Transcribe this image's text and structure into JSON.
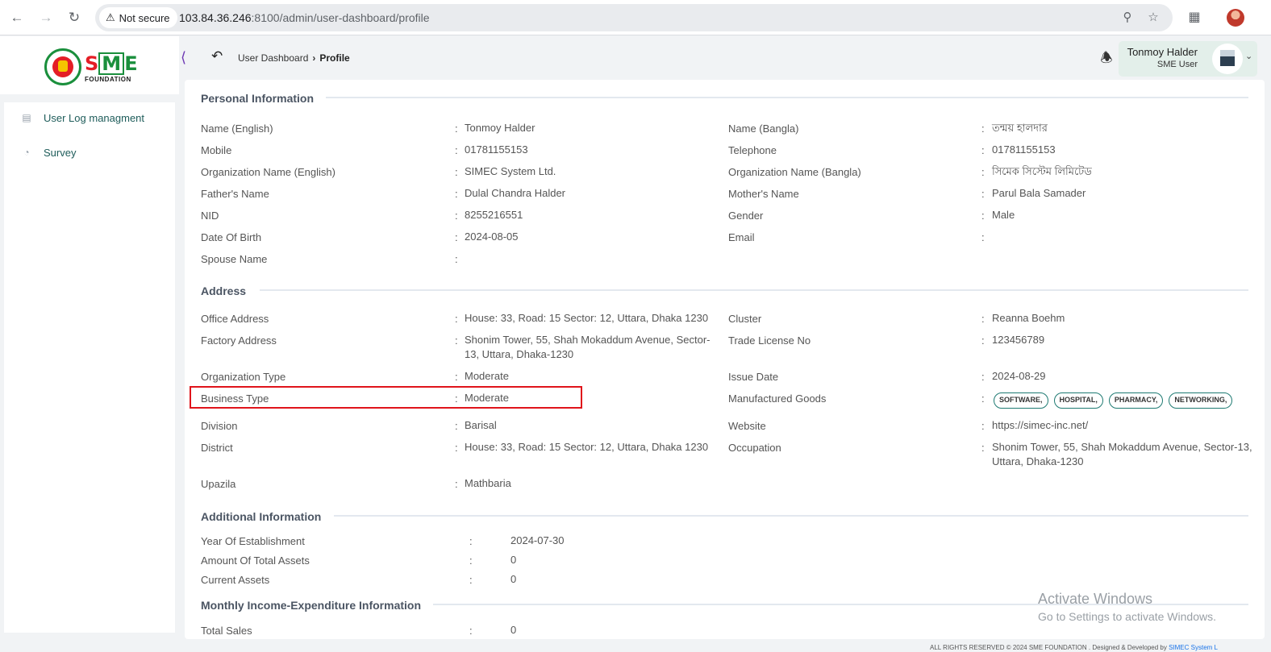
{
  "browser": {
    "security_label": "Not secure",
    "url_host": "103.84.36.246",
    "url_path": ":8100/admin/user-dashboard/profile",
    "icons": [
      "back-icon",
      "forward-icon",
      "reload-icon",
      "zoom-icon",
      "star-icon",
      "extensions-icon"
    ]
  },
  "sidebar": {
    "logo_text": "SME",
    "logo_sub": "FOUNDATION",
    "items": [
      {
        "label": "User Log managment",
        "icon": "user-log-icon"
      },
      {
        "label": "Survey",
        "icon": "pie-chart-icon"
      }
    ]
  },
  "header": {
    "breadcrumb": [
      "User Dashboard",
      "Profile"
    ],
    "user_name": "Tonmoy Halder",
    "user_role": "SME User"
  },
  "sections": {
    "personal": "Personal Information",
    "address": "Address",
    "additional": "Additional Information",
    "monthly": "Monthly Income-Expenditure Information"
  },
  "colon": ":",
  "personal": {
    "name_en": {
      "label": "Name (English)",
      "value": "Tonmoy Halder"
    },
    "name_bn": {
      "label": "Name (Bangla)",
      "value": "তন্ময় হালদার"
    },
    "mobile": {
      "label": "Mobile",
      "value": "01781155153"
    },
    "telephone": {
      "label": "Telephone",
      "value": "01781155153"
    },
    "org_en": {
      "label": "Organization Name (English)",
      "value": "SIMEC System Ltd."
    },
    "org_bn": {
      "label": "Organization Name (Bangla)",
      "value": "সিমেক সিস্টেম লিমিটেড"
    },
    "father": {
      "label": "Father's Name",
      "value": "Dulal Chandra Halder"
    },
    "mother": {
      "label": "Mother's Name",
      "value": "Parul Bala Samader"
    },
    "nid": {
      "label": "NID",
      "value": "8255216551"
    },
    "gender": {
      "label": "Gender",
      "value": "Male"
    },
    "dob": {
      "label": "Date Of Birth",
      "value": "2024-08-05"
    },
    "email": {
      "label": "Email",
      "value": ""
    },
    "spouse": {
      "label": "Spouse Name",
      "value": ""
    }
  },
  "address": {
    "office": {
      "label": "Office Address",
      "value": "House: 33, Road: 15 Sector: 12, Uttara, Dhaka 1230"
    },
    "cluster": {
      "label": "Cluster",
      "value": "Reanna Boehm"
    },
    "factory": {
      "label": "Factory Address",
      "value": "Shonim Tower, 55, Shah Mokaddum Avenue, Sector-13, Uttara, Dhaka-1230"
    },
    "trade": {
      "label": "Trade License No",
      "value": "123456789"
    },
    "org_type": {
      "label": "Organization Type",
      "value": "Moderate"
    },
    "issue_date": {
      "label": "Issue Date",
      "value": "2024-08-29"
    },
    "business_type": {
      "label": "Business Type",
      "value": "Moderate"
    },
    "goods": {
      "label": "Manufactured Goods",
      "tags": [
        "SOFTWARE,",
        "HOSPITAL,",
        "PHARMACY,",
        "NETWORKING,"
      ]
    },
    "division": {
      "label": "Division",
      "value": "Barisal"
    },
    "website": {
      "label": "Website",
      "value": "https://simec-inc.net/"
    },
    "district": {
      "label": "District",
      "value": "House: 33, Road: 15 Sector: 12, Uttara, Dhaka 1230"
    },
    "occupation": {
      "label": "Occupation",
      "value": "Shonim Tower, 55, Shah Mokaddum Avenue, Sector-13, Uttara, Dhaka-1230"
    },
    "upazila": {
      "label": "Upazila",
      "value": "Mathbaria"
    }
  },
  "additional": {
    "year": {
      "label": "Year Of Establishment",
      "value": "2024-07-30"
    },
    "total_assets": {
      "label": "Amount Of Total Assets",
      "value": "0"
    },
    "current_assets": {
      "label": "Current Assets",
      "value": "0"
    }
  },
  "monthly": {
    "total_sales": {
      "label": "Total Sales",
      "value": "0"
    }
  },
  "watermark": {
    "line1": "Activate Windows",
    "line2": "Go to Settings to activate Windows."
  },
  "footer": {
    "text": "ALL RIGHTS RESERVED © 2024 SME FOUNDATION . Designed & Developed by ",
    "brand": "SIMEC System L"
  }
}
